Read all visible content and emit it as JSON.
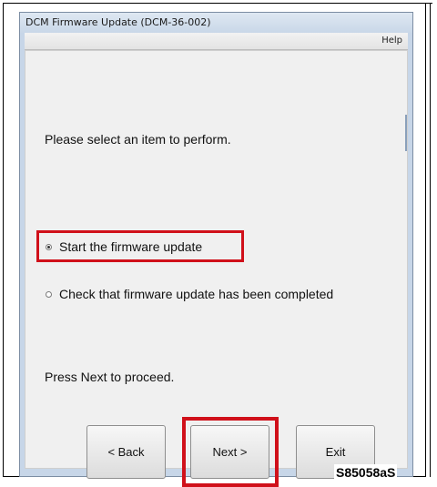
{
  "window": {
    "title": "DCM Firmware Update (DCM-36-002)",
    "menu_help": "Help"
  },
  "content": {
    "prompt": "Please select an item to perform.",
    "options": [
      {
        "label": "Start the firmware update",
        "selected": true
      },
      {
        "label": "Check that firmware update has been completed",
        "selected": false
      }
    ],
    "proceed_text": "Press Next to proceed."
  },
  "buttons": {
    "back": "< Back",
    "next": "Next >",
    "exit": "Exit"
  },
  "figure_label": "S85058aS",
  "colors": {
    "highlight": "#d0101a"
  }
}
